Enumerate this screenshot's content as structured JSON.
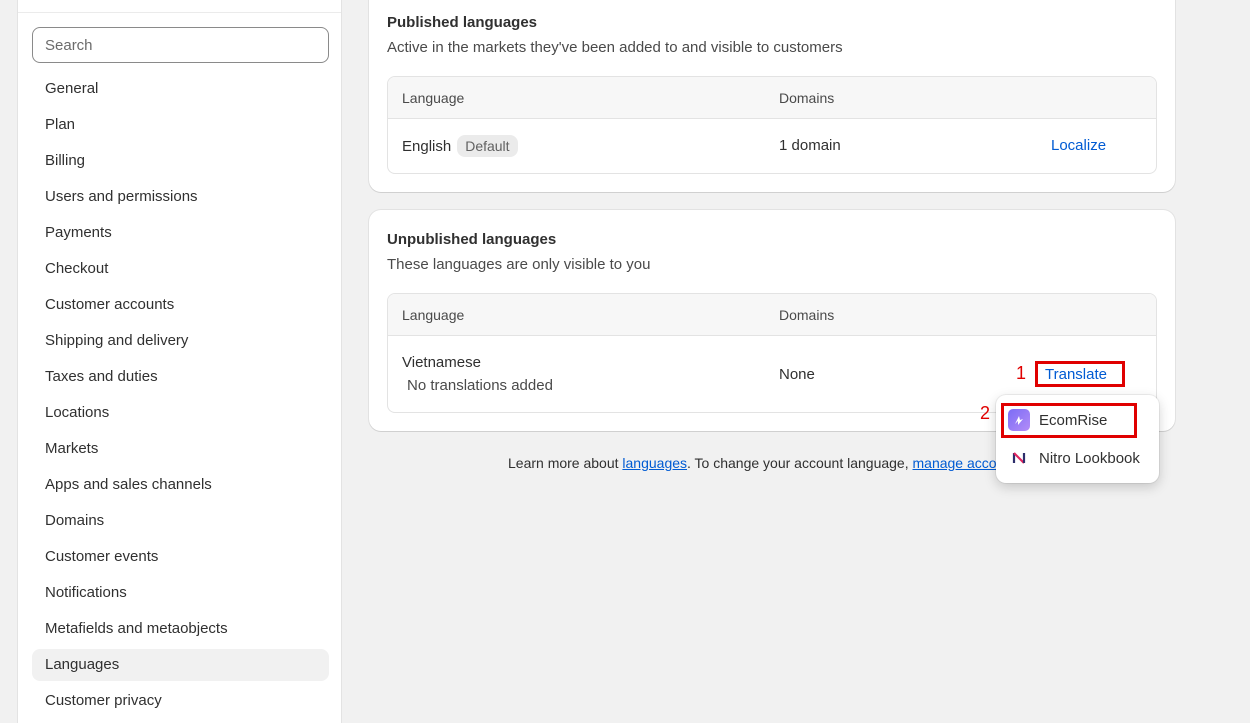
{
  "sidebar": {
    "search_placeholder": "Search",
    "items": [
      {
        "label": "General"
      },
      {
        "label": "Plan"
      },
      {
        "label": "Billing"
      },
      {
        "label": "Users and permissions"
      },
      {
        "label": "Payments"
      },
      {
        "label": "Checkout"
      },
      {
        "label": "Customer accounts"
      },
      {
        "label": "Shipping and delivery"
      },
      {
        "label": "Taxes and duties"
      },
      {
        "label": "Locations"
      },
      {
        "label": "Markets"
      },
      {
        "label": "Apps and sales channels"
      },
      {
        "label": "Domains"
      },
      {
        "label": "Customer events"
      },
      {
        "label": "Notifications"
      },
      {
        "label": "Metafields and metaobjects"
      },
      {
        "label": "Languages",
        "active": true
      },
      {
        "label": "Customer privacy"
      }
    ]
  },
  "published": {
    "title": "Published languages",
    "subtitle": "Active in the markets they've been added to and visible to customers",
    "columns": [
      "Language",
      "Domains"
    ],
    "row": {
      "language": "English",
      "badge": "Default",
      "domains": "1 domain",
      "action": "Localize"
    }
  },
  "unpublished": {
    "title": "Unpublished languages",
    "subtitle": "These languages are only visible to you",
    "columns": [
      "Language",
      "Domains"
    ],
    "row": {
      "language": "Vietnamese",
      "status": "No translations added",
      "domains": "None",
      "action": "Translate"
    }
  },
  "footer": {
    "prefix": "Learn more about ",
    "link1": "languages",
    "middle": ". To change your account language, ",
    "link2": "manage account"
  },
  "dropdown": {
    "items": [
      {
        "label": "EcomRise",
        "icon": "ecomrise-app-icon"
      },
      {
        "label": "Nitro Lookbook",
        "icon": "nitro-lookbook-app-icon"
      }
    ]
  },
  "annotations": {
    "step1": "1",
    "step2": "2",
    "color": "#e00000"
  },
  "colors": {
    "link": "#005bd3",
    "background": "#f1f1f1"
  }
}
